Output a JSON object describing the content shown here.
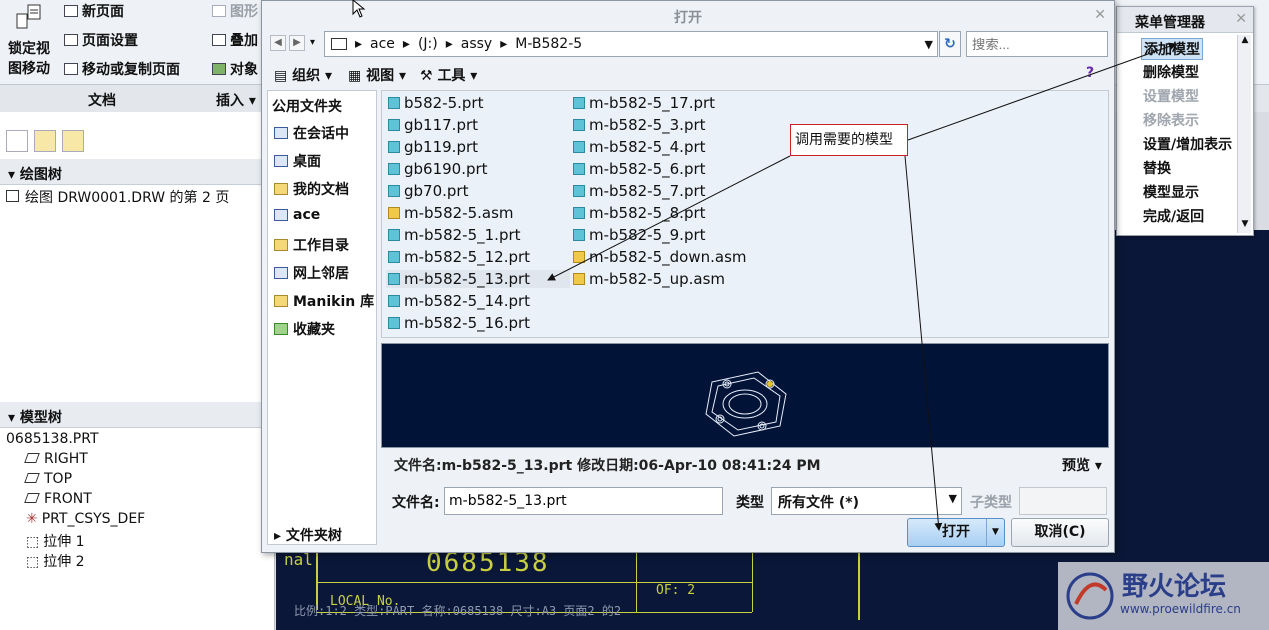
{
  "ribbon": {
    "lock_view_1": "锁定视",
    "lock_view_2": "图移动",
    "new_page": "新页面",
    "page_setup": "页面设置",
    "move_copy_page": "移动或复制页面",
    "graphic": "图形",
    "overlay": "叠加",
    "object": "对象",
    "group_document": "文档",
    "group_insert": "插入"
  },
  "left_panel": {
    "drawing_tree_title": "绘图树",
    "drawing_tree_item": "绘图 DRW0001.DRW 的第 2 页",
    "model_tree_title": "模型树",
    "model_root": "0685138.PRT",
    "features": [
      "RIGHT",
      "TOP",
      "FRONT",
      "PRT_CSYS_DEF",
      "拉伸 1",
      "拉伸 2"
    ]
  },
  "menu_manager": {
    "title": "菜单管理器",
    "items": [
      {
        "label": "添加模型",
        "state": "selected"
      },
      {
        "label": "删除模型",
        "state": "enabled"
      },
      {
        "label": "设置模型",
        "state": "disabled"
      },
      {
        "label": "移除表示",
        "state": "disabled"
      },
      {
        "label": "设置/增加表示",
        "state": "enabled"
      },
      {
        "label": "替换",
        "state": "enabled"
      },
      {
        "label": "模型显示",
        "state": "enabled"
      },
      {
        "label": "完成/返回",
        "state": "enabled"
      }
    ]
  },
  "dialog": {
    "title": "打开",
    "breadcrumb": [
      "ace",
      "(J:)",
      "assy",
      "M-B582-5"
    ],
    "search_placeholder": "搜索...",
    "toolbar": {
      "organize": "组织",
      "views": "视图",
      "tools": "工具"
    },
    "sidebar": {
      "header": "公用文件夹",
      "items": [
        "在会话中",
        "桌面",
        "我的文档",
        "ace",
        "工作目录",
        "网上邻居",
        "Manikin 库",
        "收藏夹"
      ]
    },
    "files_col1": [
      {
        "name": "b582-5.prt",
        "type": "prt"
      },
      {
        "name": "gb117.prt",
        "type": "prt"
      },
      {
        "name": "gb119.prt",
        "type": "prt"
      },
      {
        "name": "gb6190.prt",
        "type": "prt"
      },
      {
        "name": "gb70.prt",
        "type": "prt"
      },
      {
        "name": "m-b582-5.asm",
        "type": "asm"
      },
      {
        "name": "m-b582-5_1.prt",
        "type": "prt"
      },
      {
        "name": "m-b582-5_12.prt",
        "type": "prt"
      },
      {
        "name": "m-b582-5_13.prt",
        "type": "prt",
        "selected": true
      },
      {
        "name": "m-b582-5_14.prt",
        "type": "prt"
      },
      {
        "name": "m-b582-5_16.prt",
        "type": "prt"
      }
    ],
    "files_col2": [
      {
        "name": "m-b582-5_17.prt",
        "type": "prt"
      },
      {
        "name": "m-b582-5_3.prt",
        "type": "prt"
      },
      {
        "name": "m-b582-5_4.prt",
        "type": "prt"
      },
      {
        "name": "m-b582-5_6.prt",
        "type": "prt"
      },
      {
        "name": "m-b582-5_7.prt",
        "type": "prt"
      },
      {
        "name": "m-b582-5_8.prt",
        "type": "prt"
      },
      {
        "name": "m-b582-5_9.prt",
        "type": "prt"
      },
      {
        "name": "m-b582-5_down.asm",
        "type": "asm"
      },
      {
        "name": "m-b582-5_up.asm",
        "type": "asm"
      }
    ],
    "file_info": "文件名:m-b582-5_13.prt  修改日期:06-Apr-10 08:41:24 PM",
    "preview_label": "预览",
    "filename_label": "文件名:",
    "filename_value": "m-b582-5_13.prt",
    "type_label": "类型",
    "type_value": "所有文件 (*)",
    "subtype_label": "子类型",
    "open_label": "打开",
    "cancel_label": "取消(C)",
    "folder_tree_label": "文件夹树"
  },
  "callout": "调用需要的模型",
  "drawing_canvas": {
    "number": "0685138",
    "label_local": "LOCAL No.",
    "label_of": "OF: 2",
    "label_nal": "nal",
    "status": "比例:1:2    类型:PART    名称:0685138    尺寸:A3    页面2 的2"
  },
  "watermark": {
    "title": "野火论坛",
    "url": "www.proewildfire.cn"
  }
}
